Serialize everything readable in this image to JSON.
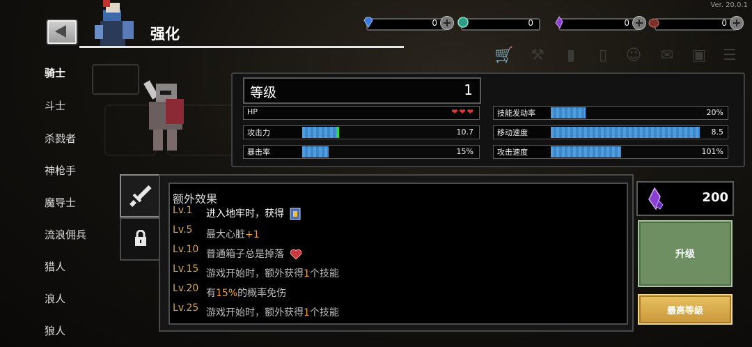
{
  "version": "Ver. 20.0.1",
  "header": {
    "title": "强化"
  },
  "currencies": [
    {
      "icon": "gem-icon",
      "value": "0"
    },
    {
      "icon": "coin-icon",
      "value": "0"
    },
    {
      "icon": "crystal-icon",
      "value": "0"
    },
    {
      "icon": "material-icon",
      "value": "0"
    }
  ],
  "classes": [
    "骑士",
    "斗士",
    "杀戮者",
    "神枪手",
    "魔导士",
    "流浪佣兵",
    "猎人",
    "浪人",
    "狼人"
  ],
  "stats": {
    "level_label": "等级",
    "level_value": "1",
    "hp_label": "HP",
    "hearts": "❤❤❤",
    "attack_label": "攻击力",
    "attack_value": "10.7",
    "attack_fill": 0.21,
    "crit_label": "暴击率",
    "crit_value": "15%",
    "crit_fill": 0.15,
    "skill_label": "技能发动率",
    "skill_value": "20%",
    "skill_fill": 0.2,
    "move_label": "移动速度",
    "move_value": "8.5",
    "move_fill": 0.85,
    "atkspeed_label": "攻击速度",
    "atkspeed_value": "101%",
    "atkspeed_fill": 0.4
  },
  "effects": {
    "title": "额外效果",
    "items": [
      {
        "lv": "Lv.1",
        "text": "进入地牢时，获得"
      },
      {
        "lv": "Lv.5",
        "text_a": "最大心脏",
        "text_hl": "+1"
      },
      {
        "lv": "Lv.10",
        "text": "普通箱子总是掉落"
      },
      {
        "lv": "Lv.15",
        "text_a": "游戏开始时，额外获得",
        "text_hl": "1",
        "text_b": "个技能"
      },
      {
        "lv": "Lv.20",
        "text_a": "有",
        "text_hl": "15%",
        "text_b": "的概率免伤"
      },
      {
        "lv": "Lv.25",
        "text_a": "游戏开始时，额外获得",
        "text_hl": "1",
        "text_b": "个技能"
      }
    ]
  },
  "cost": {
    "icon": "crystal-icon",
    "value": "200"
  },
  "buttons": {
    "upgrade": "升级",
    "max": "最高等級"
  },
  "colors": {
    "accent_gold": "#d6a75a",
    "bar_blue": "#4f9ee0",
    "upgrade_green": "#6d8f62",
    "max_gold": "#e9c262"
  }
}
